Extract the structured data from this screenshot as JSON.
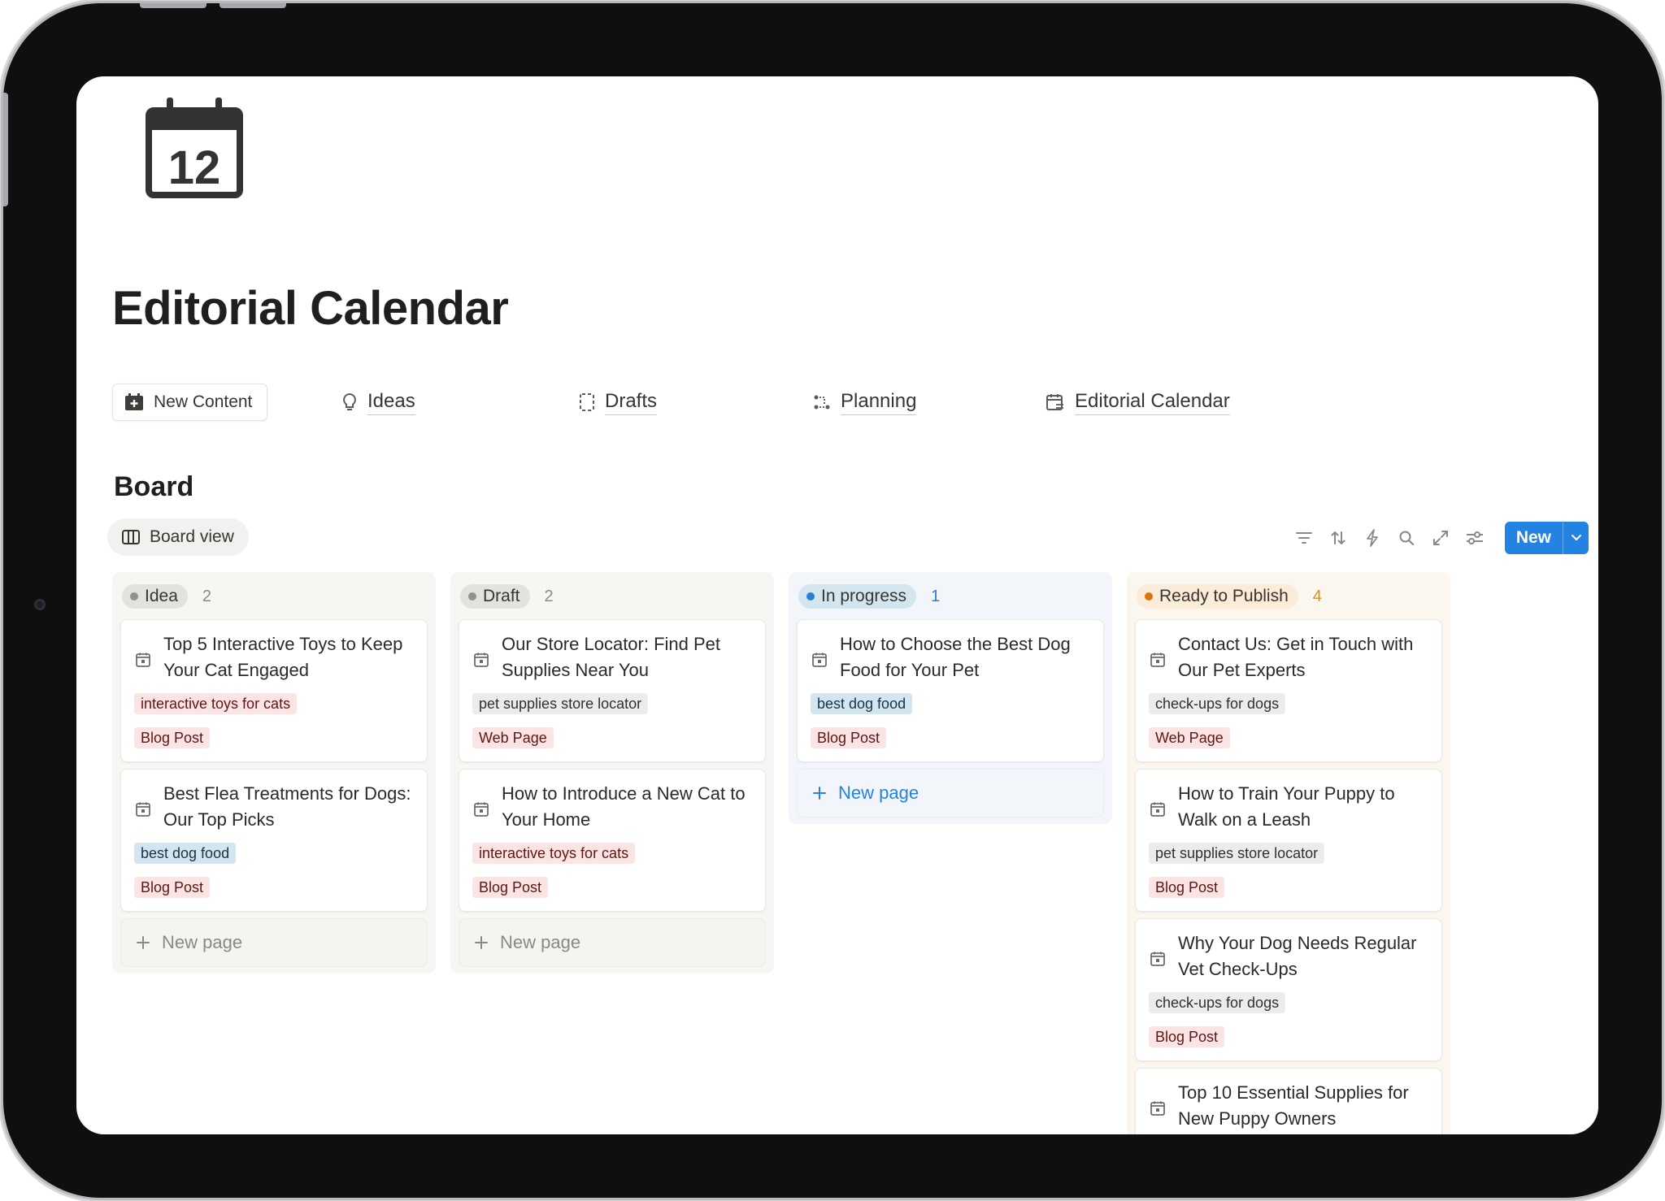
{
  "page": {
    "icon": "calendar-12-icon",
    "icon_day": "12",
    "title": "Editorial Calendar"
  },
  "links": {
    "new_content": {
      "label": "New Content",
      "icon": "calendar-plus-icon"
    },
    "ideas": {
      "label": "Ideas",
      "icon": "lightbulb-icon"
    },
    "drafts": {
      "label": "Drafts",
      "icon": "dashed-page-icon"
    },
    "planning": {
      "label": "Planning",
      "icon": "flow-icon"
    },
    "editorial_calendar": {
      "label": "Editorial Calendar",
      "icon": "calendar-list-icon"
    }
  },
  "board": {
    "title": "Board",
    "view_label": "Board view",
    "toolbar": {
      "icons": [
        "filter-icon",
        "sort-icon",
        "lightning-icon",
        "search-icon",
        "expand-icon",
        "settings-sliders-icon"
      ],
      "new_label": "New"
    },
    "new_page_label": "New page",
    "colors": {
      "accent": "#2383e2",
      "tag_red_bg": "#fbe4e4",
      "tag_red_fg": "#5d1715",
      "tag_blue_bg": "#d3e5ef",
      "tag_blue_fg": "#183347",
      "tag_gray_bg": "#ebeced",
      "tag_gray_fg": "#32302c"
    },
    "columns": [
      {
        "status": "Idea",
        "count": "2",
        "column_bg": "#f7f6f3",
        "pill_bg": "#e3e2e0",
        "dot": "#91918e",
        "count_color": "#8a8984",
        "cards": [
          {
            "title": "Top 5 Interactive Toys to Keep Your Cat Engaged",
            "keyword": "interactive toys for cats",
            "keyword_color": "red",
            "type": "Blog Post",
            "type_color": "red"
          },
          {
            "title": "Best Flea Treatments for Dogs: Our Top Picks",
            "keyword": "best dog food",
            "keyword_color": "blue",
            "type": "Blog Post",
            "type_color": "red"
          }
        ],
        "show_new_page": true
      },
      {
        "status": "Draft",
        "count": "2",
        "column_bg": "#f7f6f3",
        "pill_bg": "#e3e2e0",
        "dot": "#91918e",
        "count_color": "#8a8984",
        "cards": [
          {
            "title": "Our Store Locator: Find Pet Supplies Near You",
            "keyword": "pet supplies store locator",
            "keyword_color": "gray",
            "type": "Web Page",
            "type_color": "red"
          },
          {
            "title": "How to Introduce a New Cat to Your Home",
            "keyword": "interactive toys for cats",
            "keyword_color": "red",
            "type": "Blog Post",
            "type_color": "red"
          }
        ],
        "show_new_page": true
      },
      {
        "status": "In progress",
        "count": "1",
        "column_bg": "#f2f6fa",
        "pill_bg": "#d3e5ef",
        "dot": "#2e7cd1",
        "count_color": "#2e7cd1",
        "cards": [
          {
            "title": "How to Choose the Best Dog Food for Your Pet",
            "keyword": "best dog food",
            "keyword_color": "blue",
            "type": "Blog Post",
            "type_color": "red"
          }
        ],
        "show_new_page": true,
        "new_page_accent": true
      },
      {
        "status": "Ready to Publish",
        "count": "4",
        "column_bg": "#fbf7ef",
        "pill_bg": "#fbecd9",
        "dot": "#d9730d",
        "count_color": "#cb912f",
        "cards": [
          {
            "title": "Contact Us: Get in Touch with Our Pet Experts",
            "keyword": "check-ups for dogs",
            "keyword_color": "gray",
            "type": "Web Page",
            "type_color": "red"
          },
          {
            "title": "How to Train Your Puppy to Walk on a Leash",
            "keyword": "pet supplies store locator",
            "keyword_color": "gray",
            "type": "Blog Post",
            "type_color": "red"
          },
          {
            "title": "Why Your Dog Needs Regular Vet Check-Ups",
            "keyword": "check-ups for dogs",
            "keyword_color": "gray",
            "type": "Blog Post",
            "type_color": "red"
          },
          {
            "title": "Top 10 Essential Supplies for New Puppy Owners",
            "keyword": "",
            "keyword_color": "gray",
            "type": "",
            "type_color": "red"
          }
        ],
        "show_new_page": false
      }
    ]
  }
}
